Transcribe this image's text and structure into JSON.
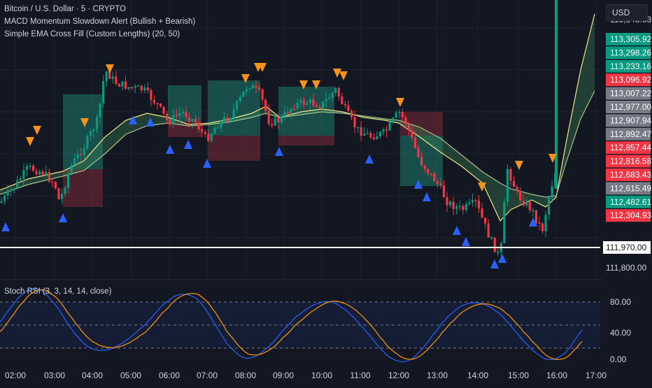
{
  "header": {
    "symbol_title": "Bitcoin / U.S. Dollar · 5 · CRYPTO",
    "indicator_1": "MACD Momentum Slowdown Alert (Bullish + Bearish)",
    "indicator_2": "Simple EMA Cross Fill (Custom Lengths) (20, 50)",
    "currency": "USD"
  },
  "price_scale": {
    "labels": [
      {
        "text": "113,305.92",
        "kind": "green",
        "val": 113305.92
      },
      {
        "text": "113,298.26",
        "kind": "green",
        "val": 113298.26
      },
      {
        "text": "113,233.16",
        "kind": "green",
        "val": 113233.16
      },
      {
        "text": "113,096.92",
        "kind": "red",
        "val": 113096.92
      },
      {
        "text": "113,007.22",
        "kind": "gray",
        "val": 113007.22
      },
      {
        "text": "112,977.00",
        "kind": "gray",
        "val": 112977.0
      },
      {
        "text": "112,907.94",
        "kind": "gray",
        "val": 112907.94
      },
      {
        "text": "112,892.47",
        "kind": "gray",
        "val": 112892.47
      },
      {
        "text": "112,857.44",
        "kind": "red",
        "val": 112857.44
      },
      {
        "text": "112,816.58",
        "kind": "red",
        "val": 112816.58
      },
      {
        "text": "112,683.43",
        "kind": "red",
        "val": 112683.43
      },
      {
        "text": "112,615.49",
        "kind": "gray",
        "val": 112615.49
      },
      {
        "text": "112,482.61",
        "kind": "green",
        "val": 112482.61
      },
      {
        "text": "112,304.93",
        "kind": "red",
        "val": 112304.93
      }
    ],
    "clipped_top_label": "113,348.63",
    "crosshair_price": "111,970.00",
    "bottom_label": "111,800.00"
  },
  "rsi": {
    "title": "Stoch RSI (3, 3, 14, 14, close)",
    "axis_labels": [
      "80.00",
      "40.00",
      "0.00"
    ],
    "upper_band": 80,
    "lower_band": 20
  },
  "time_axis": [
    "02:00",
    "03:00",
    "04:00",
    "05:00",
    "06:00",
    "07:00",
    "08:00",
    "09:00",
    "10:00",
    "11:00",
    "12:00",
    "13:00",
    "14:00",
    "15:00",
    "16:00",
    "17:00"
  ],
  "colors": {
    "background": "#131722",
    "up": "#089981",
    "down": "#f23645",
    "neutral_label": "#787b86",
    "ema_fast": "#f0e98a",
    "ema_slow": "#a8c48a",
    "buy_signal": "#2962ff",
    "sell_signal": "#f7931a",
    "rsi_k": "#2962ff",
    "rsi_d": "#ff9800"
  },
  "icons": {
    "buy": "triangle-up-icon",
    "sell": "triangle-down-icon"
  }
}
